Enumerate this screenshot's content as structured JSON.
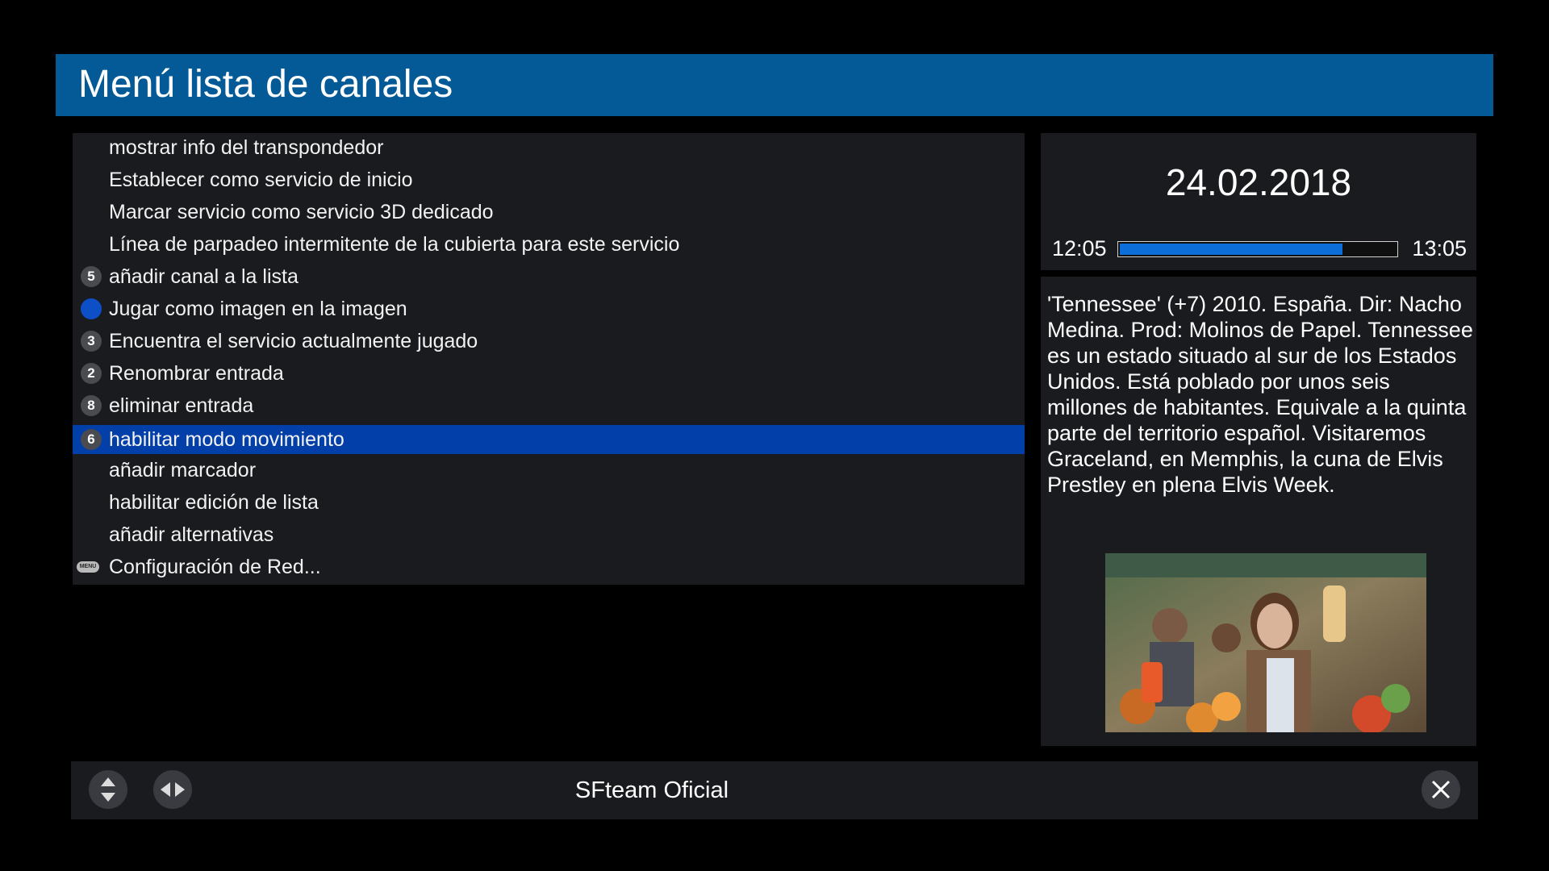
{
  "header": {
    "title": "Menú lista de canales"
  },
  "menu": {
    "items": [
      {
        "label": "mostrar info del transpondedor",
        "key": ""
      },
      {
        "label": "Establecer como servicio de inicio",
        "key": ""
      },
      {
        "label": "Marcar servicio como servicio 3D dedicado",
        "key": ""
      },
      {
        "label": "Línea de parpadeo intermitente de la cubierta para este servicio",
        "key": ""
      },
      {
        "label": "añadir canal a la lista",
        "key": "5"
      },
      {
        "label": "Jugar como imagen en la imagen",
        "key": "blue-button"
      },
      {
        "label": "Encuentra el servicio actualmente jugado",
        "key": "3"
      },
      {
        "label": "Renombrar entrada",
        "key": "2"
      },
      {
        "label": "eliminar entrada",
        "key": "8"
      },
      {
        "label": "habilitar modo movimiento",
        "key": "6"
      },
      {
        "label": "añadir marcador",
        "key": ""
      },
      {
        "label": "habilitar edición de lista",
        "key": ""
      },
      {
        "label": "añadir alternativas",
        "key": ""
      },
      {
        "label": "Configuración de Red...",
        "key": "MENU"
      }
    ],
    "selected_index": 9
  },
  "event": {
    "date": "24.02.2018",
    "start_time": "12:05",
    "end_time": "13:05",
    "progress": 0.81
  },
  "info": {
    "description": "'Tennessee' (+7) 2010. España. Dir: Nacho Medina. Prod: Molinos de Papel. Tennessee es un estado situado al sur de los Estados Unidos. Está poblado por unos seis millones de habitantes. Equivale a la quinta parte del territorio español. Visitaremos Graceland, en Memphis, la cuna de Elvis Prestley en plena Elvis Week."
  },
  "footer": {
    "title": "SFteam Oficial",
    "buttons": [
      "up-down-arrows-icon",
      "left-right-arrows-icon",
      "close-icon"
    ]
  },
  "colors": {
    "header_bg": "#045a96",
    "selected_bg": "#033fa8",
    "panel_bg": "#1a1b1f",
    "progress_fill": "#0c6ed8"
  }
}
